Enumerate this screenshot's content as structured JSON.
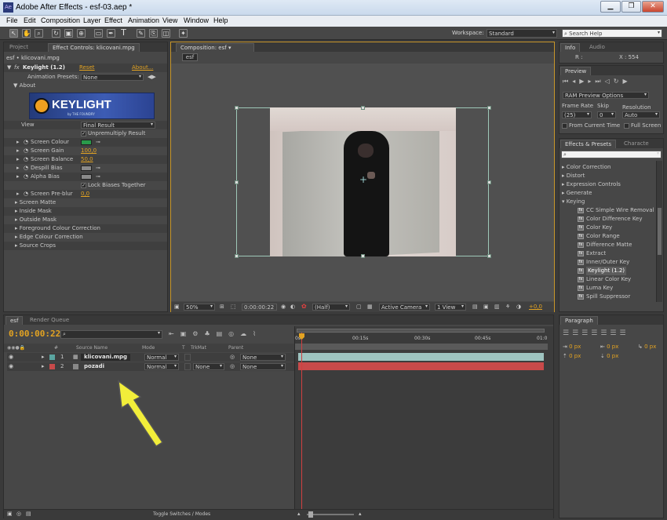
{
  "window": {
    "title": "Adobe After Effects - esf-03.aep *",
    "app_icon": "Ae",
    "controls": [
      "minimize-icon",
      "restore-icon",
      "close-icon"
    ]
  },
  "menu": [
    "File",
    "Edit",
    "Composition",
    "Layer",
    "Effect",
    "Animation",
    "View",
    "Window",
    "Help"
  ],
  "toolbar": {
    "workspace_label": "Workspace:",
    "workspace_value": "Standard",
    "search_help": "Search Help"
  },
  "effect_controls": {
    "tabs": [
      "Project",
      "Effect Controls: klicovani.mpg"
    ],
    "breadcrumb": "esf • klicovani.mpg",
    "effect_name": "Keylight (1.2)",
    "reset": "Reset",
    "about_link": "About...",
    "animation_presets_label": "Animation Presets:",
    "animation_presets_value": "None",
    "about_label": "About",
    "logo_text": "KEYLIGHT",
    "logo_subtext": "by THE FOUNDRY",
    "view_label": "View",
    "view_value": "Final Result",
    "unpremultiply": "Unpremultiply Result",
    "screen_colour": "Screen Colour",
    "screen_colour_hex": "#2a9a4a",
    "screen_gain": "Screen Gain",
    "screen_gain_value": "100,0",
    "screen_balance": "Screen Balance",
    "screen_balance_value": "50,0",
    "despill_bias": "Despill Bias",
    "alpha_bias": "Alpha Bias",
    "lock_biases": "Lock Biases Together",
    "screen_preblur": "Screen Pre-blur",
    "screen_preblur_value": "0,0",
    "groups": [
      "Screen Matte",
      "Inside Mask",
      "Outside Mask",
      "Foreground Colour Correction",
      "Edge Colour Correction",
      "Source Crops"
    ]
  },
  "composition": {
    "tab": "Composition: esf",
    "sub_tab": "esf",
    "zoom": "50%",
    "timecode": "0:00:00:22",
    "resolution": "(Half)",
    "camera": "Active Camera",
    "view": "1 View",
    "exposure": "+0,0"
  },
  "info": {
    "tabs": [
      "Info",
      "Audio"
    ],
    "r_label": "R :",
    "x_value": "X : 554"
  },
  "preview": {
    "title": "Preview",
    "ram_options": "RAM Preview Options",
    "frame_rate_label": "Frame Rate",
    "skip_label": "Skip",
    "resolution_label": "Resolution",
    "frame_rate_value": "(25)",
    "skip_value": "0",
    "resolution_value": "Auto",
    "from_current": "From Current Time",
    "full_screen": "Full Screen"
  },
  "effects_presets": {
    "tabs": [
      "Effects & Presets",
      "Characte"
    ],
    "categories": [
      "Color Correction",
      "Distort",
      "Expression Controls",
      "Generate",
      "Keying"
    ],
    "keying_items": [
      "CC Simple Wire Removal",
      "Color Difference Key",
      "Color Key",
      "Color Range",
      "Difference Matte",
      "Extract",
      "Inner/Outer Key",
      "Keylight (1.2)",
      "Linear Color Key",
      "Luma Key",
      "Spill Suppressor"
    ],
    "selected_item": "Keylight (1.2)"
  },
  "paragraph": {
    "title": "Paragraph",
    "px_values": [
      "0 px",
      "0 px",
      "0 px",
      "0 px",
      "0 px"
    ]
  },
  "timeline": {
    "tabs": [
      "esf",
      "Render Queue"
    ],
    "timecode": "0:00:00:22",
    "columns": {
      "source_name": "Source Name",
      "mode": "Mode",
      "t": "T",
      "trkmat": "TrkMat",
      "parent": "Parent",
      "number": "#"
    },
    "ruler": [
      "0s",
      "00:15s",
      "00:30s",
      "00:45s",
      "01:0"
    ],
    "layers": [
      {
        "num": "1",
        "name": "klicovani.mpg",
        "mode": "Normal",
        "trkmat": "",
        "parent": "None",
        "color": "#5aa5a0"
      },
      {
        "num": "2",
        "name": "pozadi",
        "mode": "Normal",
        "trkmat": "None",
        "parent": "None",
        "color": "#c84a4a"
      }
    ],
    "toggle_label": "Toggle Switches / Modes",
    "current_time_fraction": 0.0
  }
}
